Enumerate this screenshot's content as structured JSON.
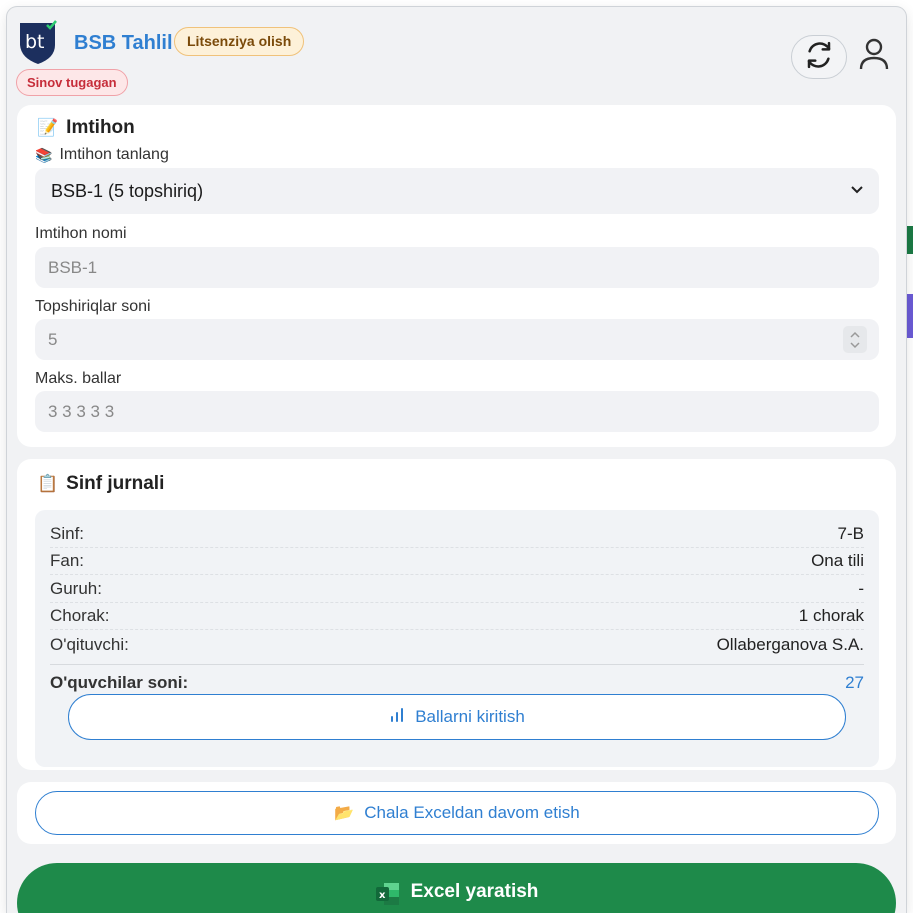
{
  "header": {
    "app_title": "BSB Tahlil",
    "license_badge": "Litsenziya olish",
    "trial_badge": "Sinov tugagan",
    "logo_text": "bt"
  },
  "exam": {
    "title": "Imtihon",
    "select_label": "Imtihon tanlang",
    "selected_exam": "BSB-1 (5 topshiriq)",
    "name_label": "Imtihon nomi",
    "name_placeholder": "BSB-1",
    "count_label": "Topshiriqlar soni",
    "count_value": "5",
    "max_label": "Maks. ballar",
    "max_placeholder": "3 3 3 3 3"
  },
  "journal": {
    "title": "Sinf jurnali",
    "rows": [
      {
        "key": "Sinf:",
        "value": "7-B"
      },
      {
        "key": "Fan:",
        "value": "Ona tili"
      },
      {
        "key": "Guruh:",
        "value": "-"
      },
      {
        "key": "Chorak:",
        "value": "1 chorak"
      },
      {
        "key": "O'qituvchi:",
        "value": "Ollaberganova S.A."
      }
    ],
    "students_label": "O'quvchilar soni:",
    "students_value": "27",
    "scores_button": "Ballarni kiritish"
  },
  "continue_button": "Chala Exceldan davom etish",
  "excel_button": "Excel yaratish",
  "colors": {
    "accent": "#2f7fd1",
    "excel_green": "#1e8a4a",
    "trial_red": "#c62d3a",
    "license_amber": "#7a4a0a"
  },
  "icons": [
    "refresh-icon",
    "user-icon",
    "memo-icon",
    "books-icon",
    "clipboard-icon",
    "chevron-down-icon",
    "bar-chart-icon",
    "folder-icon",
    "excel-icon"
  ]
}
